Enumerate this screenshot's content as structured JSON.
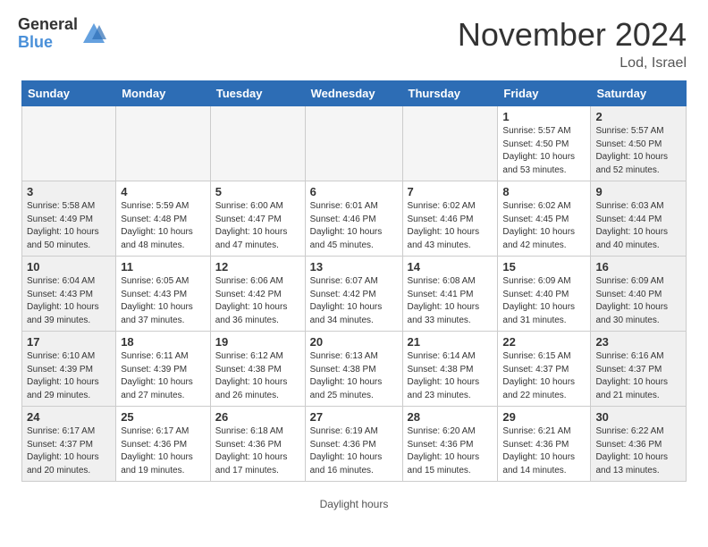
{
  "header": {
    "logo_general": "General",
    "logo_blue": "Blue",
    "month_title": "November 2024",
    "location": "Lod, Israel"
  },
  "days_of_week": [
    "Sunday",
    "Monday",
    "Tuesday",
    "Wednesday",
    "Thursday",
    "Friday",
    "Saturday"
  ],
  "weeks": [
    [
      {
        "day": "",
        "info": ""
      },
      {
        "day": "",
        "info": ""
      },
      {
        "day": "",
        "info": ""
      },
      {
        "day": "",
        "info": ""
      },
      {
        "day": "",
        "info": ""
      },
      {
        "day": "1",
        "info": "Sunrise: 5:57 AM\nSunset: 4:50 PM\nDaylight: 10 hours and 53 minutes."
      },
      {
        "day": "2",
        "info": "Sunrise: 5:57 AM\nSunset: 4:50 PM\nDaylight: 10 hours and 52 minutes."
      }
    ],
    [
      {
        "day": "3",
        "info": "Sunrise: 5:58 AM\nSunset: 4:49 PM\nDaylight: 10 hours and 50 minutes."
      },
      {
        "day": "4",
        "info": "Sunrise: 5:59 AM\nSunset: 4:48 PM\nDaylight: 10 hours and 48 minutes."
      },
      {
        "day": "5",
        "info": "Sunrise: 6:00 AM\nSunset: 4:47 PM\nDaylight: 10 hours and 47 minutes."
      },
      {
        "day": "6",
        "info": "Sunrise: 6:01 AM\nSunset: 4:46 PM\nDaylight: 10 hours and 45 minutes."
      },
      {
        "day": "7",
        "info": "Sunrise: 6:02 AM\nSunset: 4:46 PM\nDaylight: 10 hours and 43 minutes."
      },
      {
        "day": "8",
        "info": "Sunrise: 6:02 AM\nSunset: 4:45 PM\nDaylight: 10 hours and 42 minutes."
      },
      {
        "day": "9",
        "info": "Sunrise: 6:03 AM\nSunset: 4:44 PM\nDaylight: 10 hours and 40 minutes."
      }
    ],
    [
      {
        "day": "10",
        "info": "Sunrise: 6:04 AM\nSunset: 4:43 PM\nDaylight: 10 hours and 39 minutes."
      },
      {
        "day": "11",
        "info": "Sunrise: 6:05 AM\nSunset: 4:43 PM\nDaylight: 10 hours and 37 minutes."
      },
      {
        "day": "12",
        "info": "Sunrise: 6:06 AM\nSunset: 4:42 PM\nDaylight: 10 hours and 36 minutes."
      },
      {
        "day": "13",
        "info": "Sunrise: 6:07 AM\nSunset: 4:42 PM\nDaylight: 10 hours and 34 minutes."
      },
      {
        "day": "14",
        "info": "Sunrise: 6:08 AM\nSunset: 4:41 PM\nDaylight: 10 hours and 33 minutes."
      },
      {
        "day": "15",
        "info": "Sunrise: 6:09 AM\nSunset: 4:40 PM\nDaylight: 10 hours and 31 minutes."
      },
      {
        "day": "16",
        "info": "Sunrise: 6:09 AM\nSunset: 4:40 PM\nDaylight: 10 hours and 30 minutes."
      }
    ],
    [
      {
        "day": "17",
        "info": "Sunrise: 6:10 AM\nSunset: 4:39 PM\nDaylight: 10 hours and 29 minutes."
      },
      {
        "day": "18",
        "info": "Sunrise: 6:11 AM\nSunset: 4:39 PM\nDaylight: 10 hours and 27 minutes."
      },
      {
        "day": "19",
        "info": "Sunrise: 6:12 AM\nSunset: 4:38 PM\nDaylight: 10 hours and 26 minutes."
      },
      {
        "day": "20",
        "info": "Sunrise: 6:13 AM\nSunset: 4:38 PM\nDaylight: 10 hours and 25 minutes."
      },
      {
        "day": "21",
        "info": "Sunrise: 6:14 AM\nSunset: 4:38 PM\nDaylight: 10 hours and 23 minutes."
      },
      {
        "day": "22",
        "info": "Sunrise: 6:15 AM\nSunset: 4:37 PM\nDaylight: 10 hours and 22 minutes."
      },
      {
        "day": "23",
        "info": "Sunrise: 6:16 AM\nSunset: 4:37 PM\nDaylight: 10 hours and 21 minutes."
      }
    ],
    [
      {
        "day": "24",
        "info": "Sunrise: 6:17 AM\nSunset: 4:37 PM\nDaylight: 10 hours and 20 minutes."
      },
      {
        "day": "25",
        "info": "Sunrise: 6:17 AM\nSunset: 4:36 PM\nDaylight: 10 hours and 19 minutes."
      },
      {
        "day": "26",
        "info": "Sunrise: 6:18 AM\nSunset: 4:36 PM\nDaylight: 10 hours and 17 minutes."
      },
      {
        "day": "27",
        "info": "Sunrise: 6:19 AM\nSunset: 4:36 PM\nDaylight: 10 hours and 16 minutes."
      },
      {
        "day": "28",
        "info": "Sunrise: 6:20 AM\nSunset: 4:36 PM\nDaylight: 10 hours and 15 minutes."
      },
      {
        "day": "29",
        "info": "Sunrise: 6:21 AM\nSunset: 4:36 PM\nDaylight: 10 hours and 14 minutes."
      },
      {
        "day": "30",
        "info": "Sunrise: 6:22 AM\nSunset: 4:36 PM\nDaylight: 10 hours and 13 minutes."
      }
    ]
  ],
  "legend": {
    "daylight_hours": "Daylight hours"
  }
}
